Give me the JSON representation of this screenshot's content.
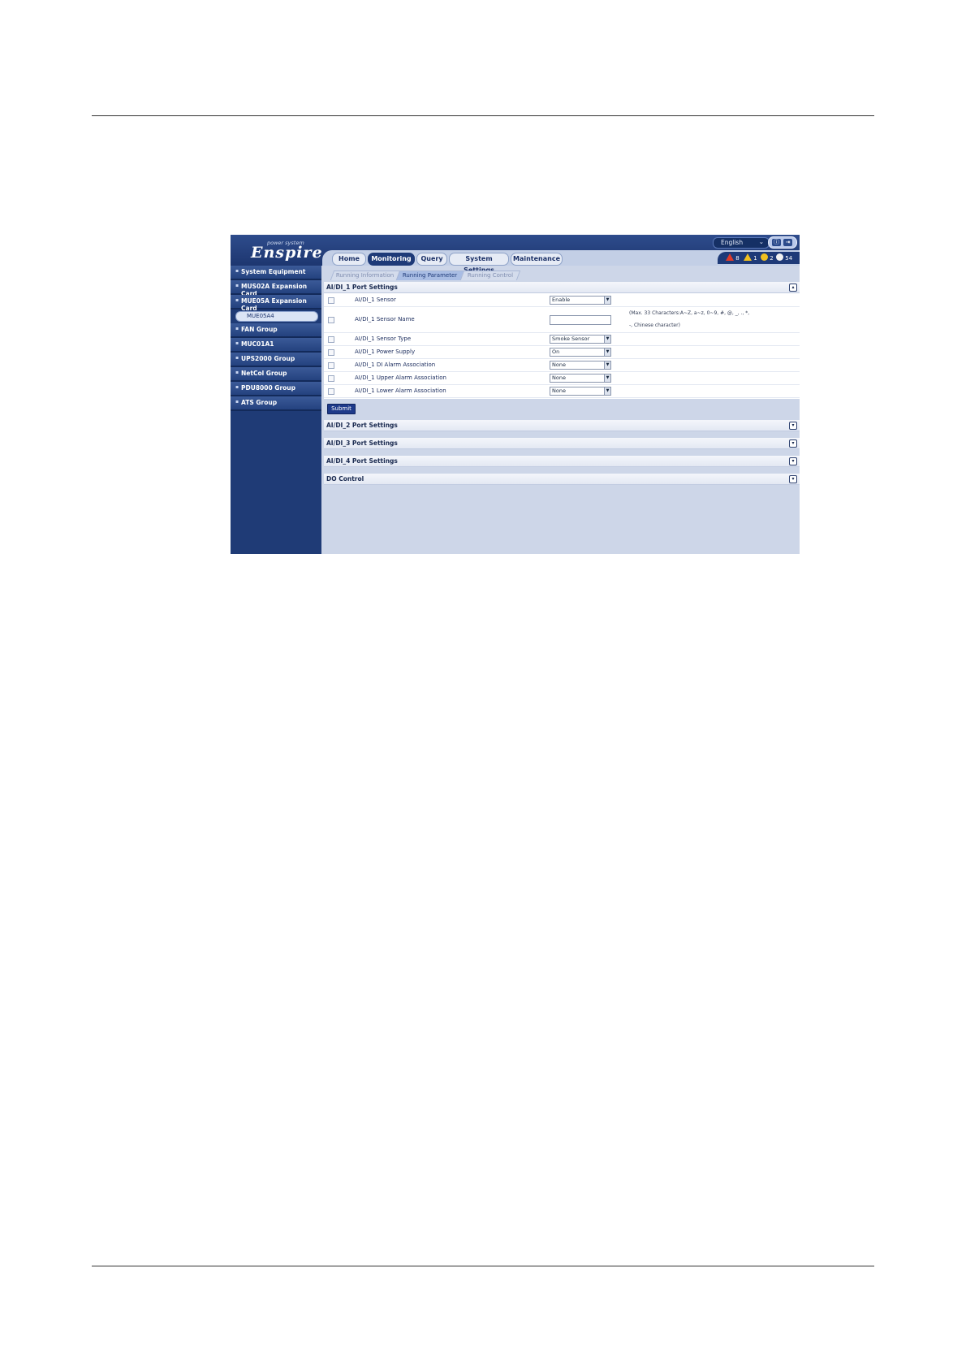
{
  "app": {
    "logo_sub": "power system",
    "logo_main": "Enspire",
    "language": "English",
    "tabs": [
      "Home",
      "Monitoring",
      "Query",
      "System Settings",
      "Maintenance"
    ],
    "alarms": {
      "critical": "8",
      "major": "1",
      "minor": "2",
      "warning": "54"
    },
    "sidebar": {
      "items": [
        "System Equipment",
        "MUS02A Expansion Card",
        "MUE05A Expansion Card",
        "FAN Group",
        "MUC01A1",
        "UPS2000 Group",
        "NetCol Group",
        "PDU8000 Group",
        "ATS Group"
      ],
      "sub_item": "MUE05A4"
    },
    "subtabs": [
      "Running Information",
      "Running Parameter",
      "Running Control"
    ],
    "section1": {
      "title": "AI/DI_1 Port Settings",
      "rows": [
        {
          "label": "AI/DI_1 Sensor",
          "value": "Enable"
        },
        {
          "label": "AI/DI_1 Sensor Name",
          "value": ""
        },
        {
          "label": "AI/DI_1 Sensor Type",
          "value": "Smoke Sensor"
        },
        {
          "label": "AI/DI_1 Power Supply",
          "value": "On"
        },
        {
          "label": "AI/DI_1 DI Alarm Association",
          "value": "None"
        },
        {
          "label": "AI/DI_1 Upper Alarm Association",
          "value": "None"
        },
        {
          "label": "AI/DI_1 Lower Alarm Association",
          "value": "None"
        }
      ],
      "name_hint_line1": "(Max. 33 Characters:A~Z, a~z, 0~9, #, @, _, ., *,",
      "name_hint_line2": "-, Chinese character)",
      "submit": "Submit"
    },
    "sections": [
      "AI/DI_2 Port Settings",
      "AI/DI_3 Port Settings",
      "AI/DI_4 Port Settings",
      "DO Control"
    ]
  }
}
